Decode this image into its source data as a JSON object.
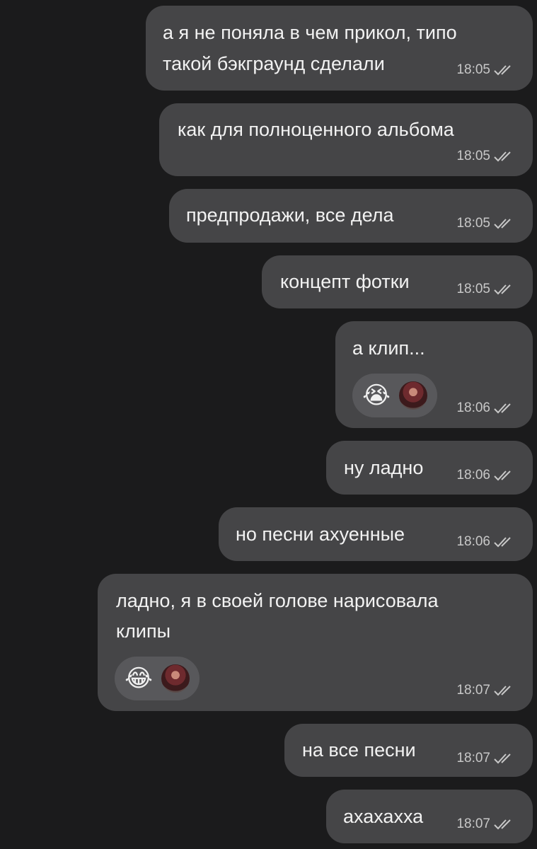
{
  "chat": {
    "background": "#1b1b1c",
    "bubble_color": "#454547",
    "messages": [
      {
        "lines": [
          "а я не поняла в чем прикол, типо",
          "такой бэкграунд сделали"
        ],
        "time": "18:05",
        "status_icon": "double-check-icon"
      },
      {
        "lines": [
          "как для полноценного альбома"
        ],
        "time": "18:05",
        "status_icon": "double-check-icon"
      },
      {
        "lines": [
          "предпродажи, все дела"
        ],
        "time": "18:05",
        "status_icon": "double-check-icon"
      },
      {
        "lines": [
          "концепт фотки"
        ],
        "time": "18:05",
        "status_icon": "double-check-icon"
      },
      {
        "lines": [
          "а клип..."
        ],
        "time": "18:06",
        "status_icon": "double-check-icon",
        "reaction": {
          "emoji": "😭",
          "emoji_name": "loudly-crying-face-icon"
        }
      },
      {
        "lines": [
          "ну ладно"
        ],
        "time": "18:06",
        "status_icon": "double-check-icon"
      },
      {
        "lines": [
          "но песни ахуенные"
        ],
        "time": "18:06",
        "status_icon": "double-check-icon"
      },
      {
        "lines": [
          "ладно, я в своей голове нарисовала",
          "клипы"
        ],
        "time": "18:07",
        "status_icon": "double-check-icon",
        "reaction": {
          "emoji": "😂",
          "emoji_name": "face-with-tears-of-joy-icon"
        }
      },
      {
        "lines": [
          "на все песни"
        ],
        "time": "18:07",
        "status_icon": "double-check-icon"
      },
      {
        "lines": [
          "ахахахха"
        ],
        "time": "18:07",
        "status_icon": "double-check-icon"
      }
    ]
  }
}
